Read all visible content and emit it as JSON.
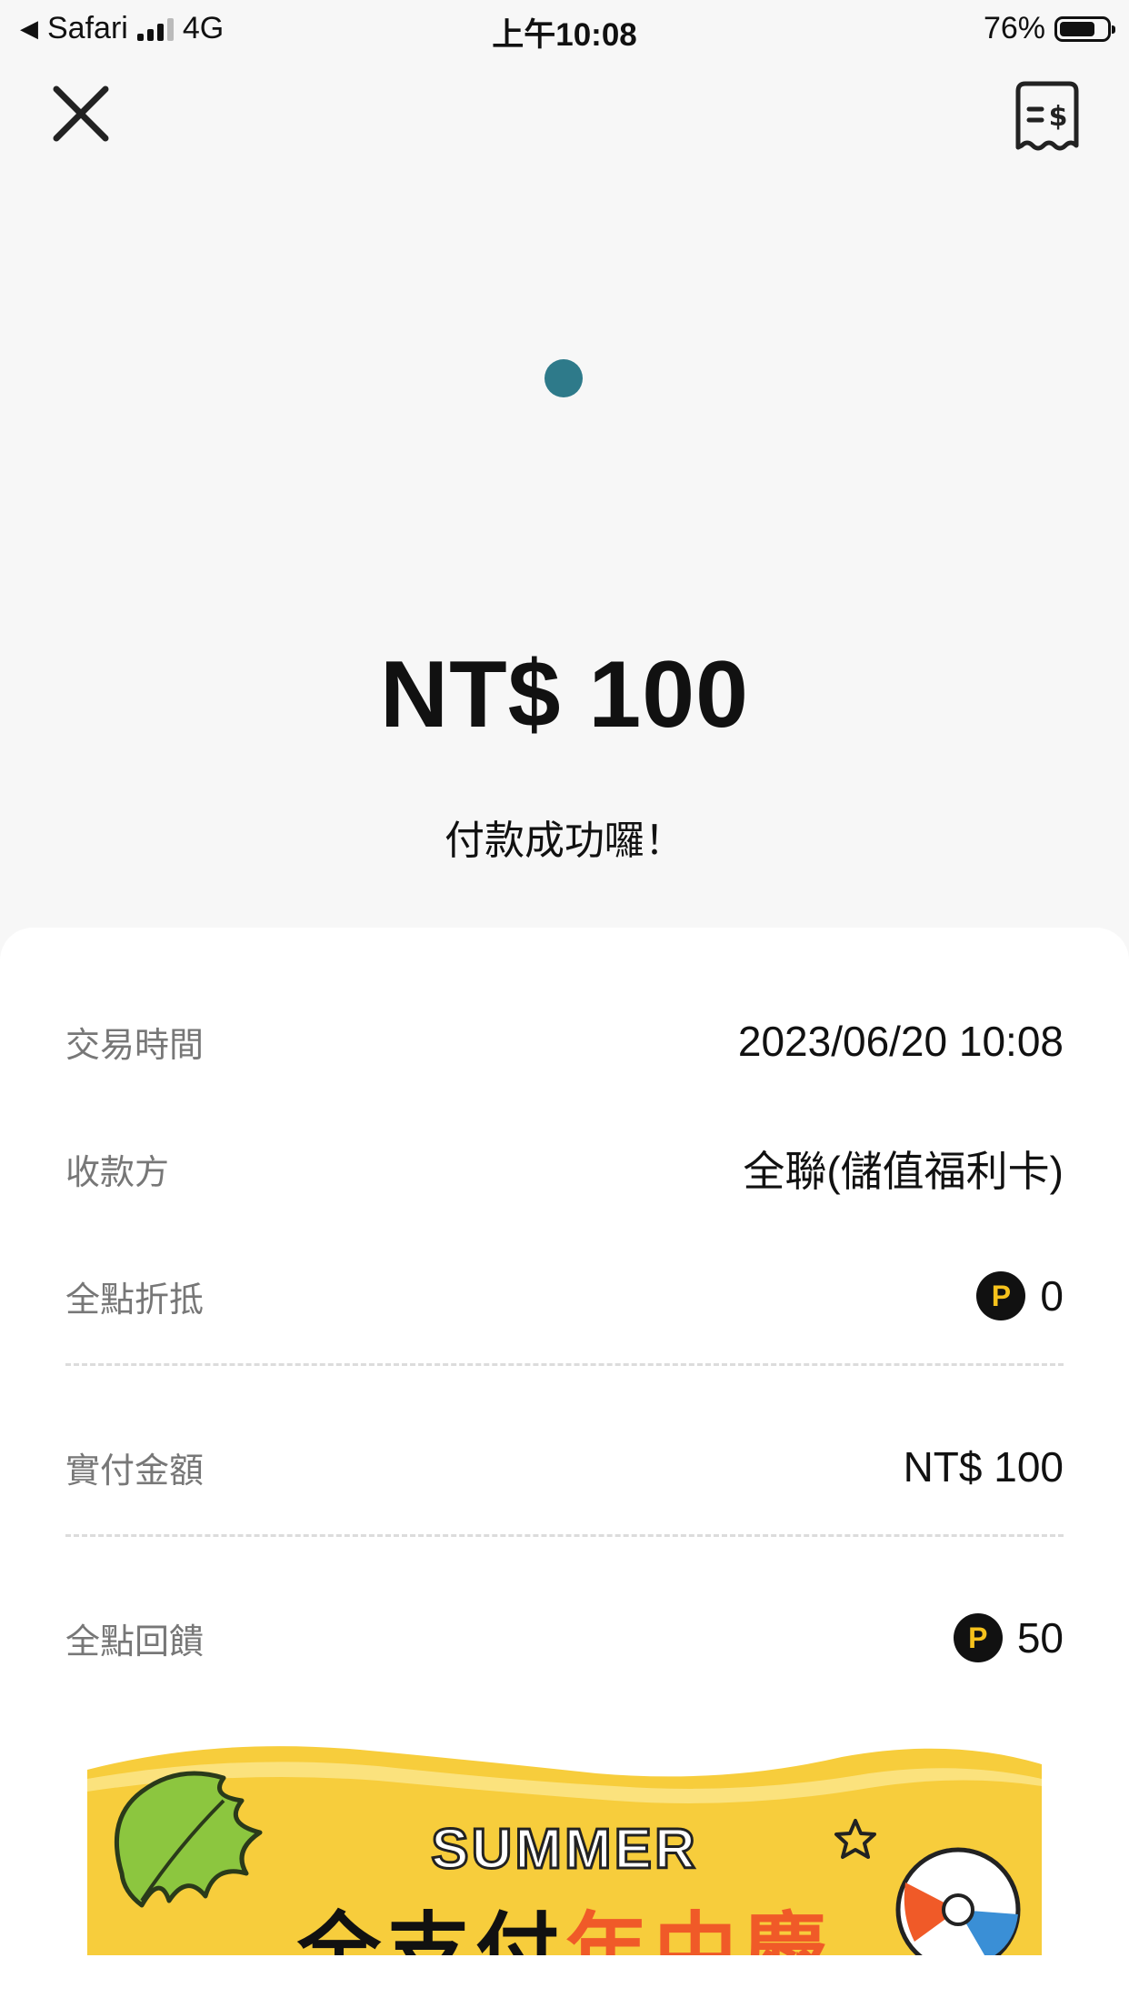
{
  "status_bar": {
    "back_app": "Safari",
    "network": "4G",
    "time": "上午10:08",
    "battery_percent": "76%",
    "battery_level": 0.76
  },
  "header": {
    "close_icon": "close-icon",
    "receipt_icon": "receipt-dollar-icon"
  },
  "payment": {
    "amount": "NT$ 100",
    "message": "付款成功囉！"
  },
  "details": {
    "time_label": "交易時間",
    "time_value": "2023/06/20 10:08",
    "payee_label": "收款方",
    "payee_value": "全聯(儲值福利卡)",
    "points_discount_label": "全點折抵",
    "points_discount_value": "0",
    "paid_label": "實付金額",
    "paid_value": "NT$ 100",
    "points_reward_label": "全點回饋",
    "points_reward_value": "50",
    "coin_letter": "P"
  },
  "banner": {
    "title": "SUMMER",
    "subtitle_part1": "全支付",
    "subtitle_part2": "年中慶"
  },
  "colors": {
    "background": "#f7f7f7",
    "card": "#ffffff",
    "dot": "#2e7a8a",
    "coin": "#f6c21c",
    "banner_yellow": "#f7cd3c",
    "banner_orange": "#f05a28"
  }
}
